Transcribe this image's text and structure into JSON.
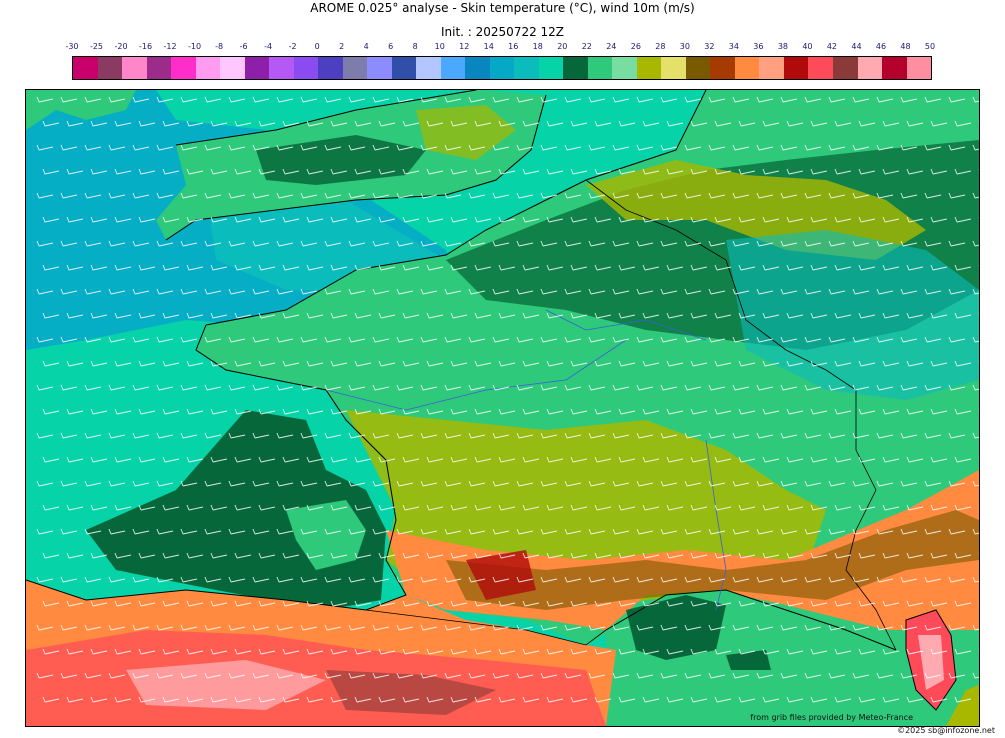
{
  "title": "AROME 0.025° analyse - Skin temperature (°C), wind 10m (m/s)",
  "subtitle": "Init. : 20250722 12Z",
  "legend": {
    "labels": [
      "-30",
      "-25",
      "-20",
      "-16",
      "-12",
      "-10",
      "-8",
      "-6",
      "-4",
      "-2",
      "0",
      "2",
      "4",
      "6",
      "8",
      "10",
      "12",
      "14",
      "16",
      "18",
      "20",
      "22",
      "24",
      "26",
      "28",
      "30",
      "32",
      "34",
      "36",
      "38",
      "40",
      "42",
      "44",
      "46",
      "48",
      "50"
    ],
    "colors": [
      "#c9006b",
      "#8b3a62",
      "#ff86c8",
      "#9b2c8a",
      "#ff2ecb",
      "#ff9cf0",
      "#ffc6ff",
      "#8e1fa8",
      "#b559f5",
      "#8a4cf0",
      "#4d3fbf",
      "#7e7cab",
      "#8c8cff",
      "#2f4fa8",
      "#b3c6ff",
      "#4aa8ff",
      "#0a86bf",
      "#06a8c8",
      "#0bbcbc",
      "#06d3a8",
      "#06683a",
      "#2ec97a",
      "#77dda0",
      "#a8b800",
      "#e4e06a",
      "#7a5a00",
      "#a63a00",
      "#ff8a40",
      "#ffa080",
      "#b00a0a",
      "#ff4a5a",
      "#8b3a3a",
      "#ffaab0",
      "#b5002e",
      "#ff8fa0"
    ]
  },
  "credits": {
    "source": "from grib files provided by Meteo-France",
    "copyright": "©2025 sb@infozone.net"
  }
}
